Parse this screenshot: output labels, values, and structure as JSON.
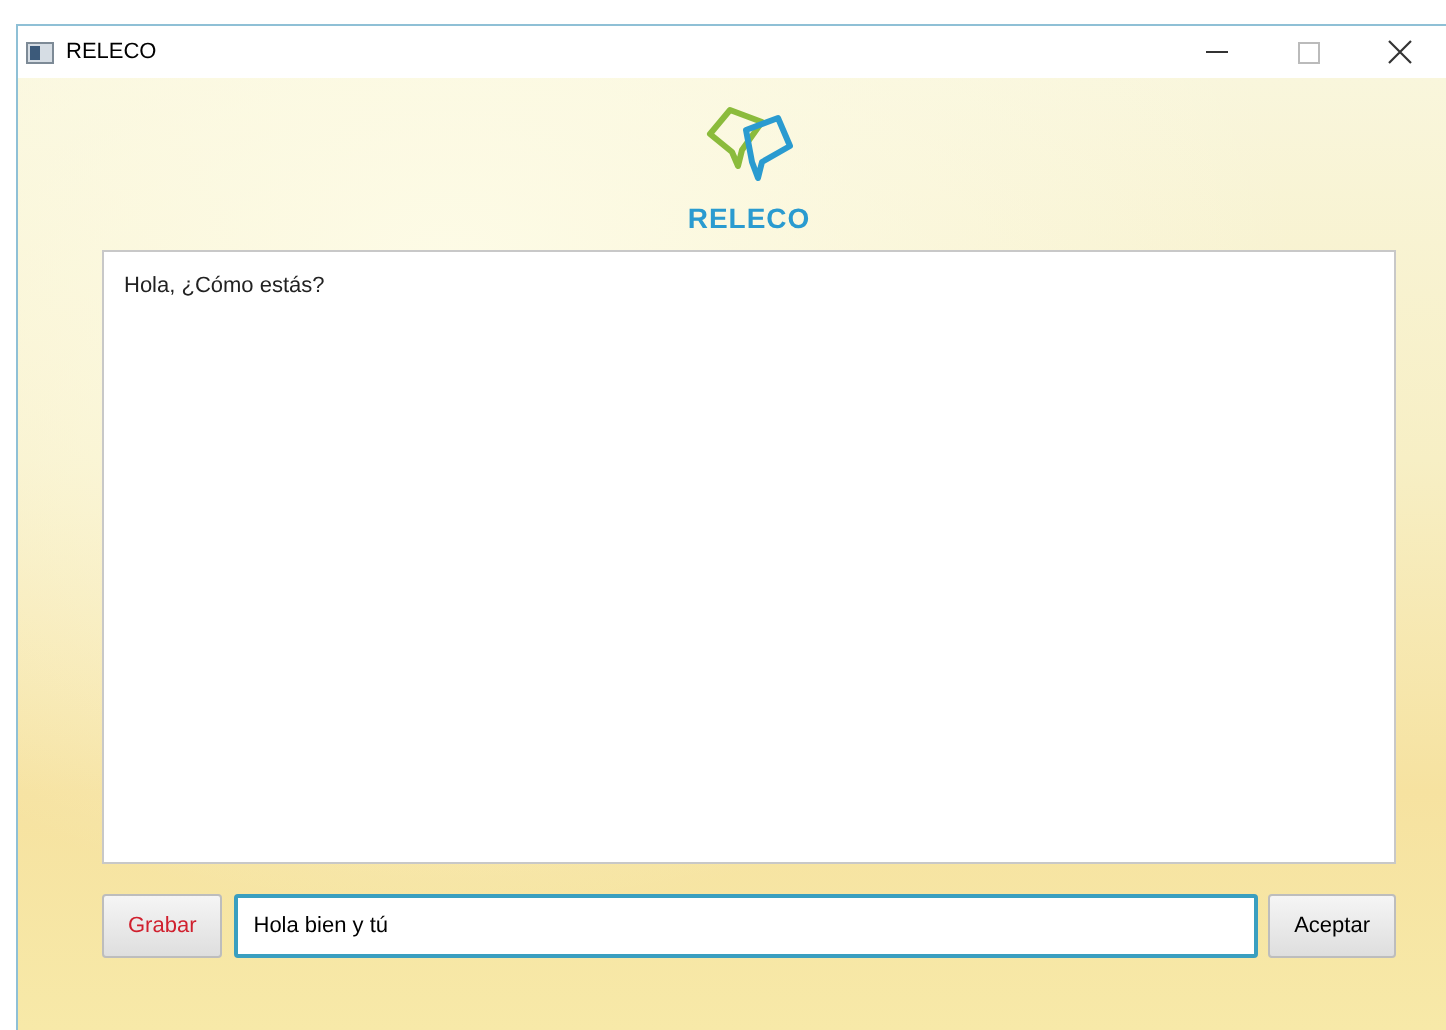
{
  "window": {
    "title": "RELECO"
  },
  "brand": {
    "name": "RELECO"
  },
  "conversation": {
    "text": "Hola, ¿Cómo estás?"
  },
  "record_button": {
    "label": "Grabar"
  },
  "message_field": {
    "value": "Hola bien y tú",
    "focused": true
  },
  "accept_button": {
    "label": "Aceptar"
  }
}
